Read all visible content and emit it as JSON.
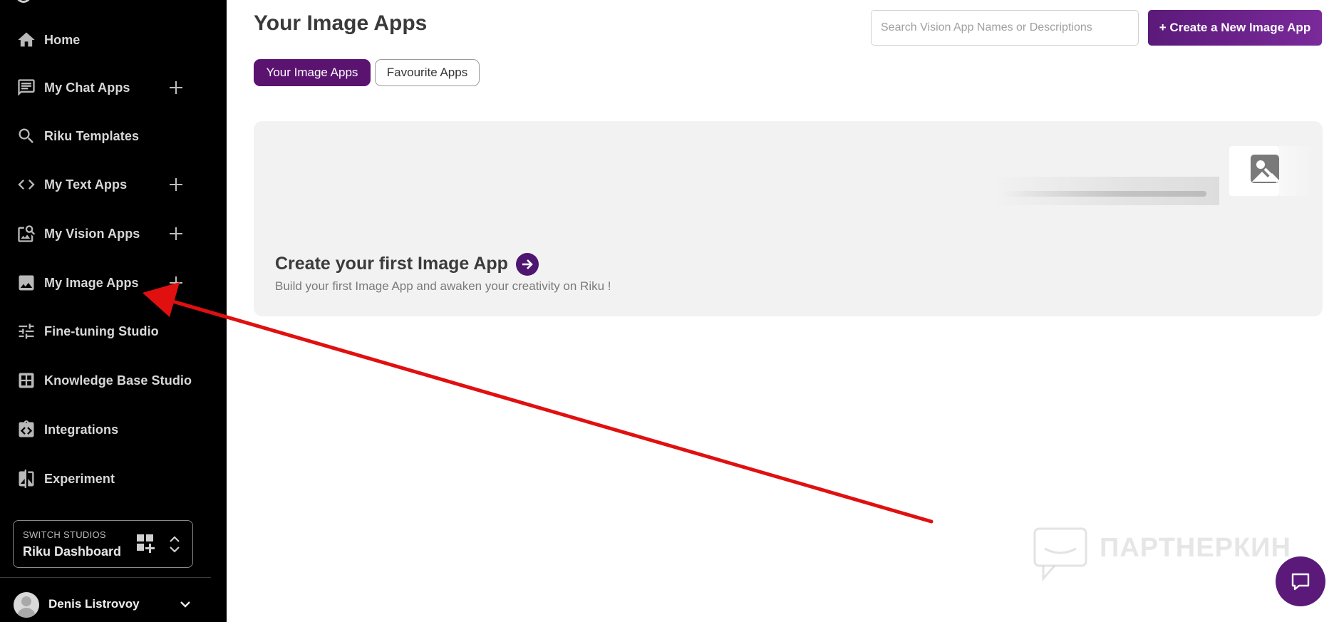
{
  "sidebar": {
    "items": [
      {
        "label": "Home",
        "icon": "home-icon",
        "has_add": false
      },
      {
        "label": "My Chat Apps",
        "icon": "chat-icon",
        "has_add": true
      },
      {
        "label": "Riku Templates",
        "icon": "search-icon",
        "has_add": false
      },
      {
        "label": "My Text Apps",
        "icon": "code-icon",
        "has_add": true
      },
      {
        "label": "My Vision Apps",
        "icon": "vision-icon",
        "has_add": true
      },
      {
        "label": "My Image Apps",
        "icon": "image-icon",
        "has_add": true
      },
      {
        "label": "Fine-tuning Studio",
        "icon": "tune-icon",
        "has_add": false
      },
      {
        "label": "Knowledge Base Studio",
        "icon": "grid-icon",
        "has_add": false
      },
      {
        "label": "Integrations",
        "icon": "integrations-icon",
        "has_add": false
      },
      {
        "label": "Experiment",
        "icon": "experiment-icon",
        "has_add": false
      }
    ],
    "switch_studios": {
      "caption": "SWITCH STUDIOS",
      "value": "Riku Dashboard"
    },
    "user": {
      "name": "Denis Listrovoy"
    }
  },
  "main": {
    "title": "Your Image Apps",
    "search_placeholder": "Search Vision App Names or Descriptions",
    "create_button": "+ Create a New Image App",
    "tabs": [
      {
        "label": "Your Image Apps",
        "active": true
      },
      {
        "label": "Favourite Apps",
        "active": false
      }
    ],
    "card": {
      "title": "Create your first Image App",
      "subtitle": "Build your first Image App and awaken your creativity on Riku !"
    }
  },
  "watermark": "ПАРТНЕРКИН",
  "colors": {
    "sidebar_bg": "#000000",
    "accent_purple": "#5b1370",
    "annotation_red": "#e01010"
  }
}
